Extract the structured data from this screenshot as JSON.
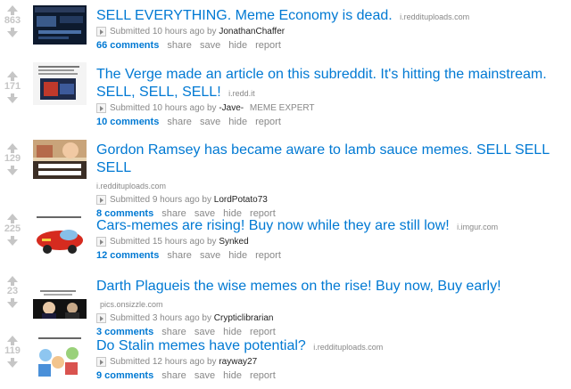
{
  "labels": {
    "submitted": "Submitted",
    "by": "by",
    "share": "share",
    "save": "save",
    "hide": "hide",
    "report": "report"
  },
  "posts": [
    {
      "score": "863",
      "title": "SELL EVERYTHING. Meme Economy is dead.",
      "domain": "i.reddituplоads.com",
      "time": "10 hours ago",
      "author": "JonathanChaffer",
      "flair": "",
      "comments": "66 comments",
      "thumb": "dark-screenshot"
    },
    {
      "score": "171",
      "title": "The Verge made an article on this subreddit. It's hitting the mainstream. SELL, SELL, SELL!",
      "domain": "i.redd.it",
      "time": "10 hours ago",
      "author": "-Jave-",
      "flair": "MEME EXPERT",
      "comments": "10 comments",
      "thumb": "article-screenshot"
    },
    {
      "score": "129",
      "title": "Gordon Ramsey has became aware to lamb sauce memes. SELL SELL SELL",
      "domain": "i.reddituplоads.com",
      "time": "9 hours ago",
      "author": "LordPotato73",
      "flair": "",
      "comments": "8 comments",
      "thumb": "where-is-the-lamb-sauce"
    },
    {
      "score": "225",
      "title": "Cars-memes are rising! Buy now while they are still low!",
      "domain": "i.imgur.com",
      "time": "15 hours ago",
      "author": "Synked",
      "flair": "",
      "comments": "12 comments",
      "thumb": "cars-meme"
    },
    {
      "score": "23",
      "title": "Darth Plagueis the wise memes on the rise! Buy now, Buy early!",
      "domain": "pics.onsizzle.com",
      "time": "3 hours ago",
      "author": "Crypticlibrarian",
      "flair": "",
      "comments": "3 comments",
      "thumb": "darth-plagueis-meme"
    },
    {
      "score": "119",
      "title": "Do Stalin memes have potential?",
      "domain": "i.reddituplоads.com",
      "time": "12 hours ago",
      "author": "rayway27",
      "flair": "",
      "comments": "9 comments",
      "thumb": "stalin-meme"
    }
  ]
}
